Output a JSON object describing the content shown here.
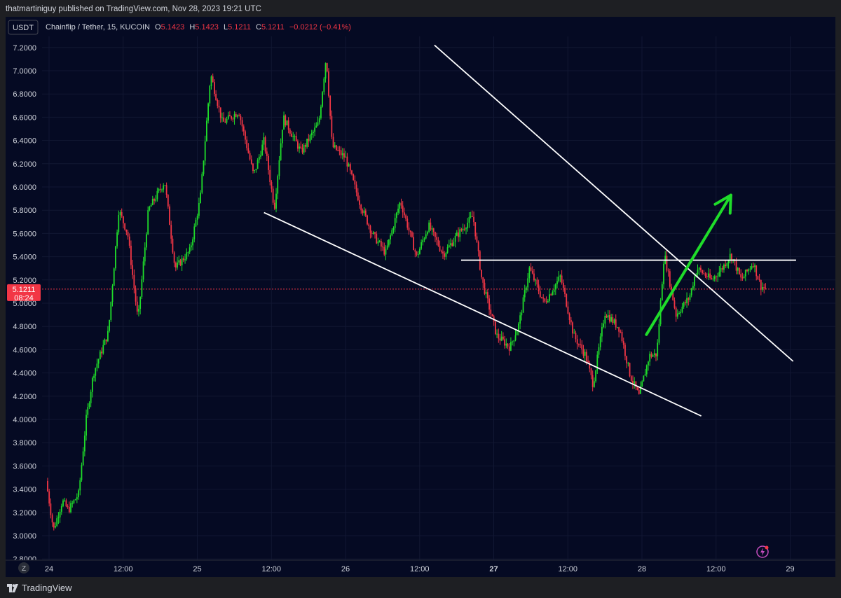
{
  "header": {
    "published_line": "thatmartiniguy published on TradingView.com, Nov 28, 2023 19:21 UTC"
  },
  "chart_header": {
    "currency_badge": "USDT",
    "symbol": "Chainflip / Tether, 15, KUCOIN",
    "o_label": "O",
    "o_value": "5.1423",
    "h_label": "H",
    "h_value": "5.1423",
    "l_label": "L",
    "l_value": "5.1211",
    "c_label": "C",
    "c_value": "5.1211",
    "change": "−0.0212 (−0.41%)"
  },
  "footer": {
    "brand": "TradingView",
    "timezone_button": "Z"
  },
  "colors": {
    "background": "#050a23",
    "up_candle": "#1fdc2a",
    "down_candle": "#f23645",
    "price_line": "#f23645",
    "arrow": "#1fdc2a",
    "trendlines": "#ffffff"
  },
  "icons": [
    "tradingview-logo-icon",
    "lightning-alert-icon"
  ],
  "chart_data": {
    "type": "candlestick",
    "title": "Chainflip / Tether, 15, KUCOIN",
    "ylim": [
      2.8,
      7.3
    ],
    "y_ticks": [
      "7.2000",
      "7.0000",
      "6.8000",
      "6.6000",
      "6.4000",
      "6.2000",
      "6.0000",
      "5.8000",
      "5.6000",
      "5.4000",
      "5.2000",
      "5.0000",
      "4.8000",
      "4.6000",
      "4.4000",
      "4.2000",
      "4.0000",
      "3.8000",
      "3.6000",
      "3.4000",
      "3.2000",
      "3.0000",
      "2.8000"
    ],
    "x_ticks": [
      {
        "label": "24",
        "t": 0
      },
      {
        "label": "12:00",
        "t": 0.5
      },
      {
        "label": "25",
        "t": 1
      },
      {
        "label": "12:00",
        "t": 1.5
      },
      {
        "label": "26",
        "t": 2
      },
      {
        "label": "12:00",
        "t": 2.5
      },
      {
        "label": "27",
        "t": 3,
        "bold": true
      },
      {
        "label": "12:00",
        "t": 3.5
      },
      {
        "label": "28",
        "t": 4
      },
      {
        "label": "12:00",
        "t": 4.5
      },
      {
        "label": "29",
        "t": 5
      }
    ],
    "last_price": {
      "value": "5.1211",
      "countdown": "08:24",
      "y": 5.1211
    },
    "price_path": [
      [
        -0.02,
        3.47
      ],
      [
        0.03,
        3.05
      ],
      [
        0.09,
        3.3
      ],
      [
        0.13,
        3.22
      ],
      [
        0.2,
        3.36
      ],
      [
        0.25,
        4.0
      ],
      [
        0.3,
        4.4
      ],
      [
        0.4,
        4.75
      ],
      [
        0.47,
        5.8
      ],
      [
        0.53,
        5.6
      ],
      [
        0.6,
        4.85
      ],
      [
        0.67,
        5.8
      ],
      [
        0.78,
        6.05
      ],
      [
        0.85,
        5.3
      ],
      [
        0.95,
        5.45
      ],
      [
        1.02,
        5.9
      ],
      [
        1.09,
        6.97
      ],
      [
        1.17,
        6.55
      ],
      [
        1.28,
        6.65
      ],
      [
        1.38,
        6.1
      ],
      [
        1.45,
        6.4
      ],
      [
        1.52,
        5.82
      ],
      [
        1.58,
        6.6
      ],
      [
        1.7,
        6.3
      ],
      [
        1.82,
        6.55
      ],
      [
        1.87,
        7.13
      ],
      [
        1.91,
        6.35
      ],
      [
        2.0,
        6.25
      ],
      [
        2.1,
        5.85
      ],
      [
        2.18,
        5.6
      ],
      [
        2.27,
        5.43
      ],
      [
        2.37,
        5.88
      ],
      [
        2.48,
        5.4
      ],
      [
        2.56,
        5.67
      ],
      [
        2.66,
        5.42
      ],
      [
        2.75,
        5.58
      ],
      [
        2.86,
        5.75
      ],
      [
        2.92,
        5.2
      ],
      [
        3.02,
        4.72
      ],
      [
        3.11,
        4.62
      ],
      [
        3.17,
        4.82
      ],
      [
        3.24,
        5.3
      ],
      [
        3.34,
        5.0
      ],
      [
        3.45,
        5.23
      ],
      [
        3.54,
        4.72
      ],
      [
        3.62,
        4.55
      ],
      [
        3.67,
        4.3
      ],
      [
        3.75,
        4.92
      ],
      [
        3.85,
        4.78
      ],
      [
        3.92,
        4.38
      ],
      [
        3.98,
        4.2
      ],
      [
        4.05,
        4.55
      ],
      [
        4.1,
        4.56
      ],
      [
        4.15,
        5.43
      ],
      [
        4.23,
        4.9
      ],
      [
        4.32,
        5.05
      ],
      [
        4.37,
        5.3
      ],
      [
        4.47,
        5.2
      ],
      [
        4.54,
        5.3
      ],
      [
        4.6,
        5.42
      ],
      [
        4.67,
        5.2
      ],
      [
        4.75,
        5.35
      ],
      [
        4.8,
        5.15
      ],
      [
        4.84,
        5.12
      ]
    ],
    "annotations": [
      {
        "kind": "trendline",
        "from": [
          2.6,
          7.22
        ],
        "to": [
          5.02,
          4.5
        ]
      },
      {
        "kind": "trendline",
        "from": [
          1.45,
          5.78
        ],
        "to": [
          4.4,
          4.03
        ]
      },
      {
        "kind": "horizontal",
        "from": [
          2.78,
          5.37
        ],
        "to": [
          5.04,
          5.37
        ]
      },
      {
        "kind": "arrow",
        "from": [
          4.03,
          4.73
        ],
        "to": [
          4.6,
          5.93
        ]
      }
    ]
  }
}
